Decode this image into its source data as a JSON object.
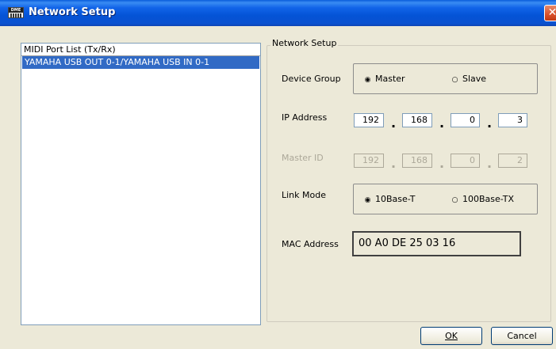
{
  "window": {
    "title": "Network Setup",
    "close_glyph": "✕"
  },
  "midi_list": {
    "header": "MIDI Port List (Tx/Rx)",
    "items": [
      "YAMAHA USB OUT 0-1/YAMAHA USB IN 0-1"
    ],
    "selected_index": 0
  },
  "network": {
    "group_title": "Network Setup",
    "device_group": {
      "label": "Device Group",
      "options": [
        "Master",
        "Slave"
      ],
      "selected": "Master"
    },
    "ip_address": {
      "label": "IP Address",
      "octets": [
        "192",
        "168",
        "0",
        "3"
      ]
    },
    "master_id": {
      "label": "Master ID",
      "octets": [
        "192",
        "168",
        "0",
        "2"
      ],
      "enabled": false
    },
    "link_mode": {
      "label": "Link Mode",
      "options": [
        "10Base-T",
        "100Base-TX"
      ],
      "selected": "10Base-T"
    },
    "mac_address": {
      "label": "MAC Address",
      "value": "00 A0 DE 25 03 16"
    }
  },
  "buttons": {
    "ok": "OK",
    "cancel": "Cancel"
  },
  "colors": {
    "title_bar": "#0a52d0",
    "selection": "#316ac5",
    "dialog_bg": "#ece9d8"
  }
}
